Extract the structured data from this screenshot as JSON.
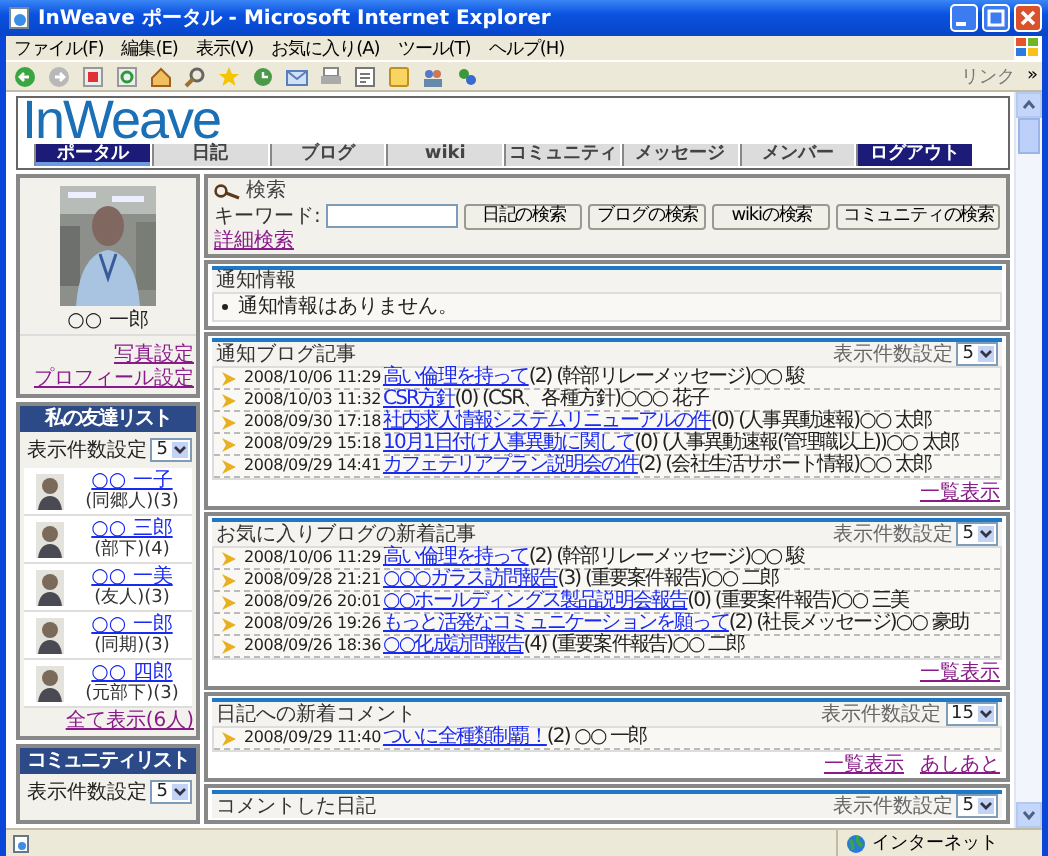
{
  "window": {
    "title": "InWeave ポータル - Microsoft Internet Explorer"
  },
  "menu": [
    "ファイル(F)",
    "編集(E)",
    "表示(V)",
    "お気に入り(A)",
    "ツール(T)",
    "ヘルプ(H)"
  ],
  "toolbar": {
    "links_label": "リンク",
    "chevron": "»"
  },
  "site": {
    "logo": "InWeave",
    "nav": [
      {
        "label": "ポータル",
        "selected": true,
        "kind": "tab"
      },
      {
        "label": "日記",
        "selected": false,
        "kind": "tab"
      },
      {
        "label": "ブログ",
        "selected": false,
        "kind": "tab"
      },
      {
        "label": "wiki",
        "selected": false,
        "kind": "tab"
      },
      {
        "label": "コミュニティ",
        "selected": false,
        "kind": "tab"
      },
      {
        "label": "メッセージ",
        "selected": false,
        "kind": "tab"
      },
      {
        "label": "メンバー",
        "selected": false,
        "kind": "tab"
      },
      {
        "label": "ログアウト",
        "selected": false,
        "kind": "logout"
      }
    ]
  },
  "profile": {
    "name": "○○ 一郎",
    "links": [
      "写真設定",
      "プロフィール設定"
    ]
  },
  "friends": {
    "title": "私の友達リスト",
    "count_label": "表示件数設定",
    "count": "5",
    "items": [
      {
        "name": "○○ 一子",
        "relation": "(同郷人)(3)"
      },
      {
        "name": "○○ 三郎",
        "relation": "(部下)(4)"
      },
      {
        "name": "○○ 一美",
        "relation": "(友人)(3)"
      },
      {
        "name": "○○ 一郎",
        "relation": "(同期)(3)"
      },
      {
        "name": "○○ 四郎",
        "relation": "(元部下)(3)"
      }
    ],
    "more": "全て表示(6人)"
  },
  "communities": {
    "title": "コミュニティリスト",
    "count_label": "表示件数設定",
    "count": "5"
  },
  "search": {
    "title": "検索",
    "keyword_label": "キーワード:",
    "buttons": [
      "日記の検索",
      "ブログの検索",
      "wikiの検索",
      "コミュニティの検索"
    ],
    "advanced": "詳細検索"
  },
  "notices": {
    "title": "通知情報",
    "items": [
      "通知情報はありません。"
    ]
  },
  "sections": [
    {
      "title": "通知ブログ記事",
      "count_label": "表示件数設定",
      "count": "5",
      "rows": [
        {
          "date": "2008/10/06 11:29",
          "title": "高い倫理を持って",
          "info": "(2) (幹部リレーメッセージ)○○ 駿"
        },
        {
          "date": "2008/10/03 11:32",
          "title": "CSR方針",
          "info": "(0) (CSR、各種方針)○○○ 花子"
        },
        {
          "date": "2008/09/30 17:18",
          "title": "社内求人情報システムリニューアルの件",
          "info": "(0) (人事異動速報)○○ 太郎"
        },
        {
          "date": "2008/09/29 15:18",
          "title": "10月1日付け人事異動に関して",
          "info": "(0) (人事異動速報(管理職以上))○○ 太郎"
        },
        {
          "date": "2008/09/29 14:41",
          "title": "カフェテリアプラン説明会の件",
          "info": "(2) (会社生活サポート情報)○○ 太郎"
        }
      ],
      "links": [
        "一覧表示"
      ]
    },
    {
      "title": "お気に入りブログの新着記事",
      "count_label": "表示件数設定",
      "count": "5",
      "rows": [
        {
          "date": "2008/10/06 11:29",
          "title": "高い倫理を持って",
          "info": "(2) (幹部リレーメッセージ)○○ 駿"
        },
        {
          "date": "2008/09/28 21:21",
          "title": "○○○ガラス訪問報告",
          "info": "(3) (重要案件報告)○○ 二郎"
        },
        {
          "date": "2008/09/26 20:01",
          "title": "○○ホールディングス製品説明会報告",
          "info": "(0) (重要案件報告)○○ 三美"
        },
        {
          "date": "2008/09/26 19:26",
          "title": "もっと活発なコミュニケーションを願って",
          "info": "(2) (社長メッセージ)○○ 豪助"
        },
        {
          "date": "2008/09/26 18:36",
          "title": "○○化成訪問報告",
          "info": "(4) (重要案件報告)○○ 二郎"
        }
      ],
      "links": [
        "一覧表示"
      ]
    },
    {
      "title": "日記への新着コメント",
      "count_label": "表示件数設定",
      "count": "15",
      "rows": [
        {
          "date": "2008/09/29 11:40",
          "title": "ついに全種類制覇！",
          "info": "(2) ○○ 一郎"
        }
      ],
      "links": [
        "一覧表示",
        "あしあと"
      ]
    },
    {
      "title": "コメントした日記",
      "count_label": "表示件数設定",
      "count": "5"
    }
  ],
  "status_bar": {
    "zone": "インターネット"
  }
}
